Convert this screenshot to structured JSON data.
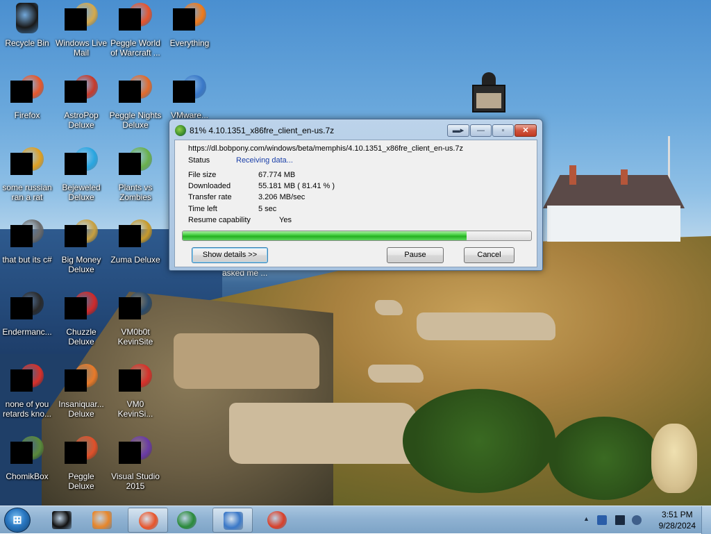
{
  "desktop": {
    "icons": [
      {
        "label": "Recycle Bin",
        "icon": "recycle-bin-icon"
      },
      {
        "label": "Windows Live Mail",
        "icon": "windows-live-mail-icon"
      },
      {
        "label": "Peggle World of Warcraft ...",
        "icon": "peggle-icon"
      },
      {
        "label": "Everything",
        "icon": "everything-search-icon"
      },
      {
        "label": "Firefox",
        "icon": "firefox-icon"
      },
      {
        "label": "AstroPop Deluxe",
        "icon": "astropop-icon"
      },
      {
        "label": "Peggle Nights Deluxe",
        "icon": "peggle-nights-icon"
      },
      {
        "label": "VMware...",
        "icon": "vmware-icon"
      },
      {
        "label": "some russian ran a rat",
        "icon": "file-icon"
      },
      {
        "label": "Bejeweled Deluxe",
        "icon": "bejeweled-icon"
      },
      {
        "label": "Plants vs Zombies",
        "icon": "plants-vs-zombies-icon"
      },
      {
        "label": "that but its c#",
        "icon": "file-icon"
      },
      {
        "label": "Big Money Deluxe",
        "icon": "big-money-icon"
      },
      {
        "label": "Zuma Deluxe",
        "icon": "zuma-icon"
      },
      {
        "label": "Endermanc...",
        "icon": "file-icon"
      },
      {
        "label": "Chuzzle Deluxe",
        "icon": "chuzzle-icon"
      },
      {
        "label": "VM0b0t KevinSite",
        "icon": "file-icon"
      },
      {
        "label": "none of you retards kno...",
        "icon": "opera-icon"
      },
      {
        "label": "Insaniquar... Deluxe",
        "icon": "insaniquarium-icon"
      },
      {
        "label": "VM0 KevinSi...",
        "icon": "opera-icon"
      },
      {
        "label": "ChomikBox",
        "icon": "chomikbox-icon"
      },
      {
        "label": "Peggle Deluxe",
        "icon": "peggle-icon"
      },
      {
        "label": "Visual Studio 2015",
        "icon": "visual-studio-icon"
      }
    ],
    "partial_icon_label": "asked me ..."
  },
  "dialog": {
    "title": "81% 4.10.1351_x86fre_client_en-us.7z",
    "url": "https://dl.bobpony.com/windows/beta/memphis/4.10.1351_x86fre_client_en-us.7z",
    "status_label": "Status",
    "status_value": "Receiving data...",
    "rows": [
      {
        "label": "File size",
        "value": "67.774  MB"
      },
      {
        "label": "Downloaded",
        "value": "55.181  MB  ( 81.41 % )"
      },
      {
        "label": "Transfer rate",
        "value": "3.206  MB/sec"
      },
      {
        "label": "Time left",
        "value": "5 sec"
      },
      {
        "label": "Resume capability",
        "value": "Yes"
      }
    ],
    "progress_percent": 81.41,
    "show_details_label": "Show details >>",
    "pause_label": "Pause",
    "cancel_label": "Cancel",
    "colors": {
      "progress": "#3ecb3a",
      "status_text": "#1a3fa8",
      "close_button": "#c03a22"
    }
  },
  "taskbar": {
    "start_label": "⊞",
    "items": [
      {
        "name": "taskbar-app-1",
        "icon": "black-app-icon",
        "active": false
      },
      {
        "name": "taskbar-media-player",
        "icon": "media-player-icon",
        "active": false
      },
      {
        "name": "taskbar-firefox",
        "icon": "firefox-icon",
        "active": true
      },
      {
        "name": "taskbar-idm",
        "icon": "download-manager-icon",
        "active": false
      },
      {
        "name": "taskbar-vmware",
        "icon": "vmware-icon",
        "active": true
      },
      {
        "name": "taskbar-chrome",
        "icon": "chrome-icon",
        "active": false
      }
    ],
    "tray_chevron": "▲",
    "time": "3:51 PM",
    "date": "9/28/2024"
  }
}
